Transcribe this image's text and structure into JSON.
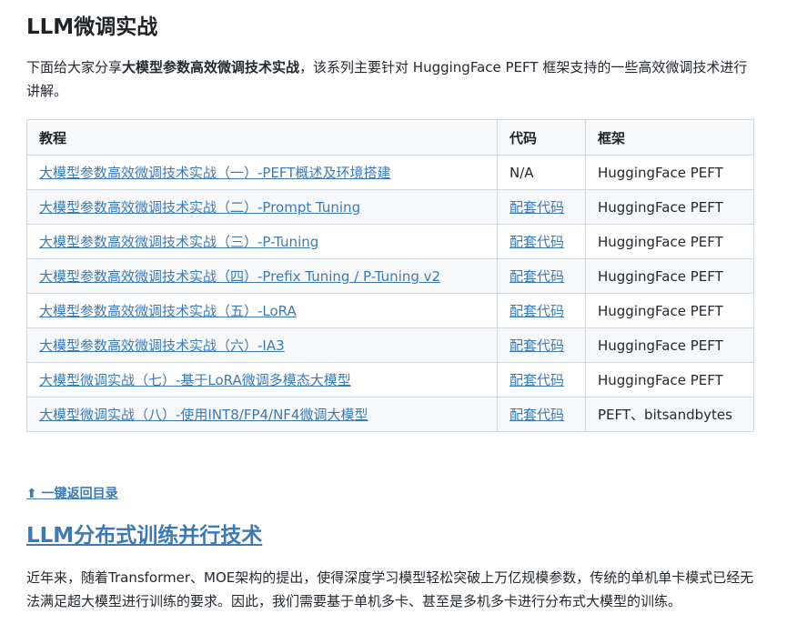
{
  "section1": {
    "title": "LLM微调实战",
    "intro_prefix": "下面给大家分享",
    "intro_bold": "大模型参数高效微调技术实战",
    "intro_suffix": "，该系列主要针对 HuggingFace PEFT 框架支持的一些高效微调技术进行讲解。"
  },
  "table": {
    "headers": [
      "教程",
      "代码",
      "框架"
    ],
    "rows": [
      {
        "tutorial": "大模型参数高效微调技术实战（一）-PEFT概述及环境搭建",
        "code": "N/A",
        "code_is_link": false,
        "framework": "HuggingFace PEFT"
      },
      {
        "tutorial": "大模型参数高效微调技术实战（二）-Prompt Tuning",
        "code": "配套代码",
        "code_is_link": true,
        "framework": "HuggingFace PEFT"
      },
      {
        "tutorial": "大模型参数高效微调技术实战（三）-P-Tuning",
        "code": "配套代码",
        "code_is_link": true,
        "framework": "HuggingFace PEFT"
      },
      {
        "tutorial": "大模型参数高效微调技术实战（四）-Prefix Tuning / P-Tuning v2",
        "code": "配套代码",
        "code_is_link": true,
        "framework": "HuggingFace PEFT"
      },
      {
        "tutorial": "大模型参数高效微调技术实战（五）-LoRA",
        "code": "配套代码",
        "code_is_link": true,
        "framework": "HuggingFace PEFT"
      },
      {
        "tutorial": "大模型参数高效微调技术实战（六）-IA3",
        "code": "配套代码",
        "code_is_link": true,
        "framework": "HuggingFace PEFT"
      },
      {
        "tutorial": "大模型微调实战（七）-基于LoRA微调多模态大模型",
        "code": "配套代码",
        "code_is_link": true,
        "framework": "HuggingFace PEFT"
      },
      {
        "tutorial": "大模型微调实战（八）-使用INT8/FP4/NF4微调大模型",
        "code": "配套代码",
        "code_is_link": true,
        "framework": "PEFT、bitsandbytes"
      }
    ]
  },
  "back_link": "⬆ 一键返回目录",
  "section2": {
    "title": "LLM分布式训练并行技术",
    "desc": "近年来，随着Transformer、MOE架构的提出，使得深度学习模型轻松突破上万亿规模参数，传统的单机单卡模式已经无法满足超大模型进行训练的要求。因此，我们需要基于单机多卡、甚至是多机多卡进行分布式大模型的训练。"
  },
  "colors": {
    "link": "#3d7ab3",
    "text": "#24292f",
    "table_border": "#d0d7de",
    "table_stripe": "#f6f8fa"
  }
}
